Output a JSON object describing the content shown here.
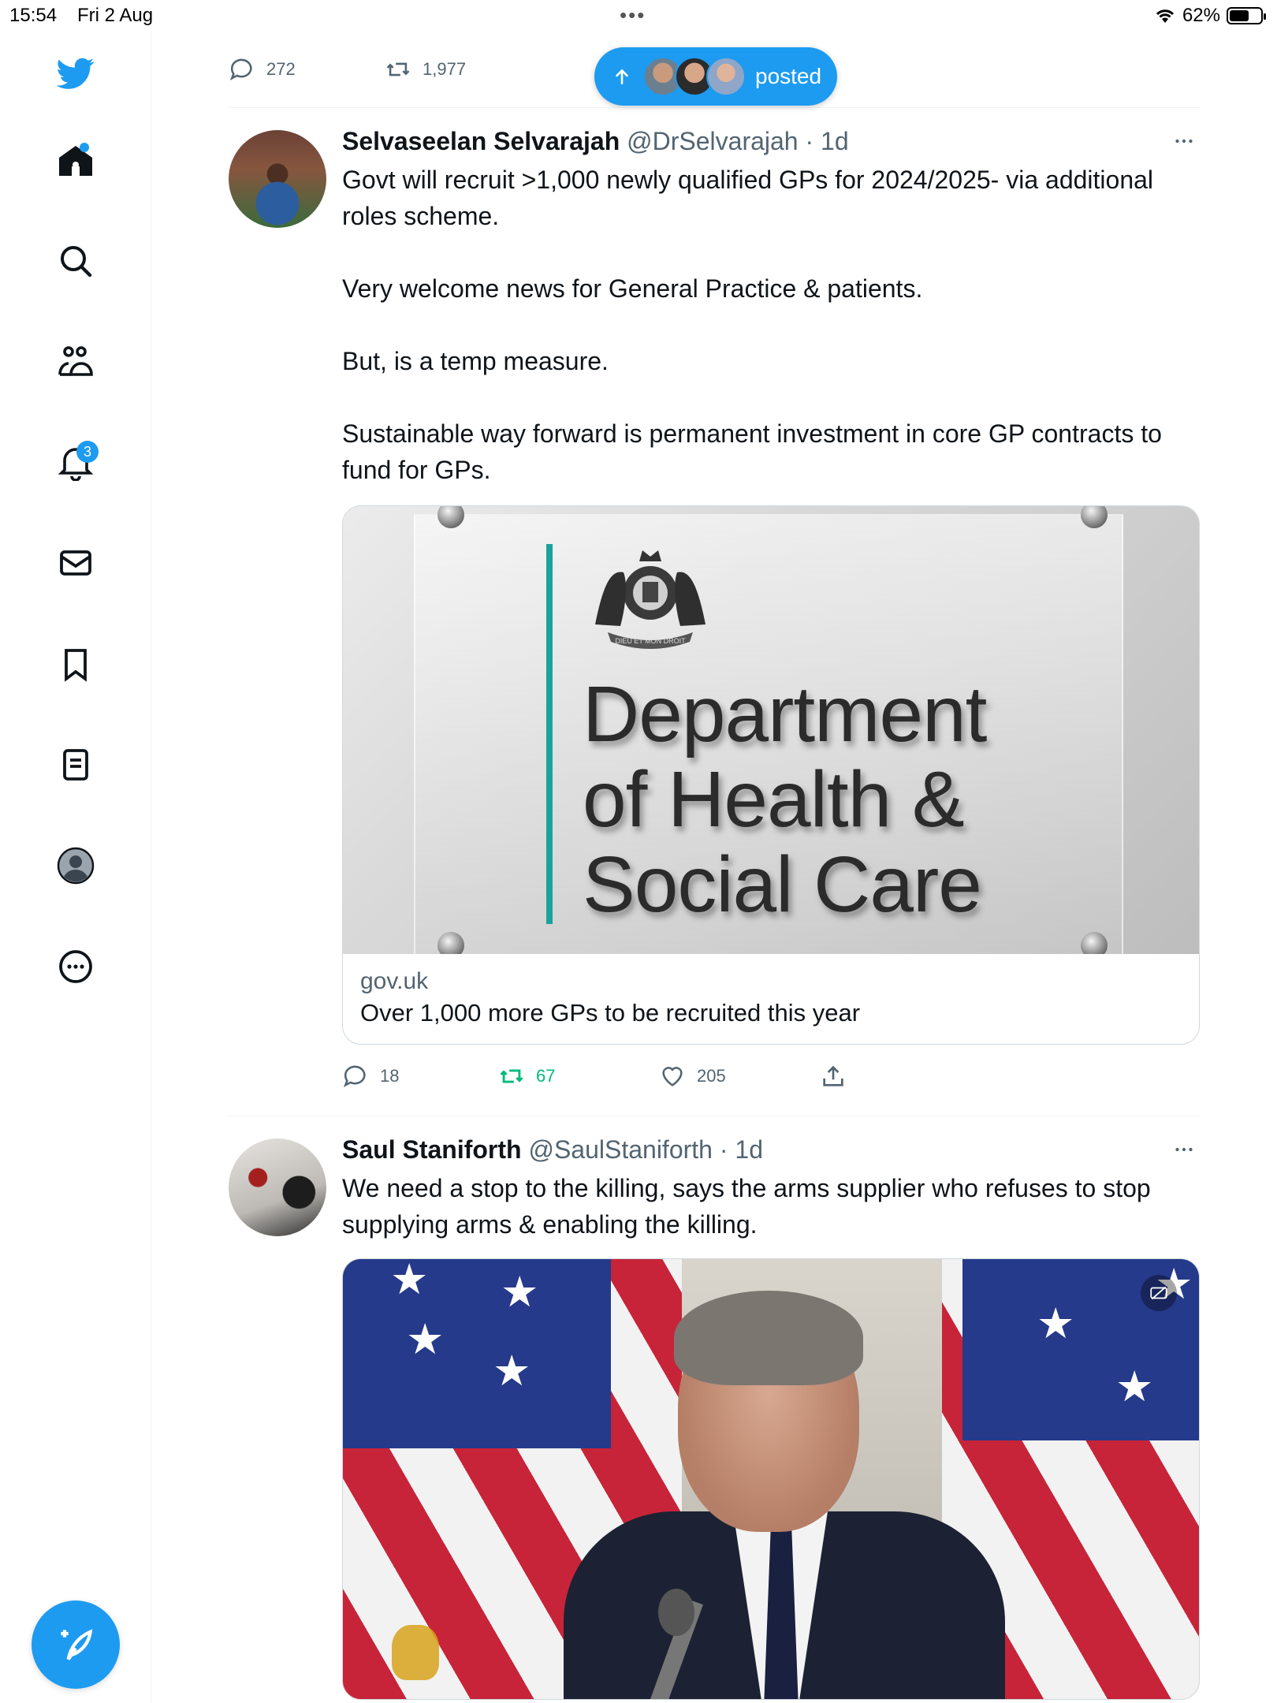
{
  "status_bar": {
    "time": "15:54",
    "date": "Fri 2 Aug",
    "battery": "62%",
    "battery_level": 0.62
  },
  "sidebar": {
    "notifications_badge": "3"
  },
  "previous_tweet": {
    "replies": "272",
    "retweets": "1,977"
  },
  "new_posts_pill": {
    "label": "posted"
  },
  "tweets": [
    {
      "name": "Selvaseelan Selvarajah",
      "handle": "@DrSelvarajah",
      "time": "· 1d",
      "text": [
        "Govt will recruit >1,000 newly qualified GPs for 2024/2025- via additional roles scheme.",
        "Very welcome news for General Practice & patients.",
        "But, is a temp measure.",
        "Sustainable way forward is permanent investment in core GP contracts to fund for GPs."
      ],
      "card": {
        "image_text": [
          "Department",
          "of Health &",
          "Social Care"
        ],
        "crest_motto": "DIEU ET MON DROIT",
        "domain": "gov.uk",
        "title": "Over 1,000 more GPs to be recruited this year"
      },
      "replies": "18",
      "retweets": "67",
      "likes": "205"
    },
    {
      "name": "Saul Staniforth",
      "handle": "@SaulStaniforth",
      "time": "· 1d",
      "text": [
        "We need a stop to the killing, says the arms supplier who refuses to stop supplying arms & enabling the killing."
      ]
    }
  ],
  "colors": {
    "accent": "#1d9bf0",
    "retweeted": "#00ba7c",
    "secondary_text": "#536471",
    "border": "#eff3f4"
  },
  "icons": [
    "twitter-logo-icon",
    "home-icon",
    "search-icon",
    "communities-icon",
    "notifications-bell-icon",
    "messages-icon",
    "bookmarks-icon",
    "lists-icon",
    "profile-icon",
    "more-icon",
    "compose-icon",
    "reply-icon",
    "retweet-icon",
    "like-icon",
    "share-icon",
    "more-dots-icon",
    "gif-icon"
  ]
}
